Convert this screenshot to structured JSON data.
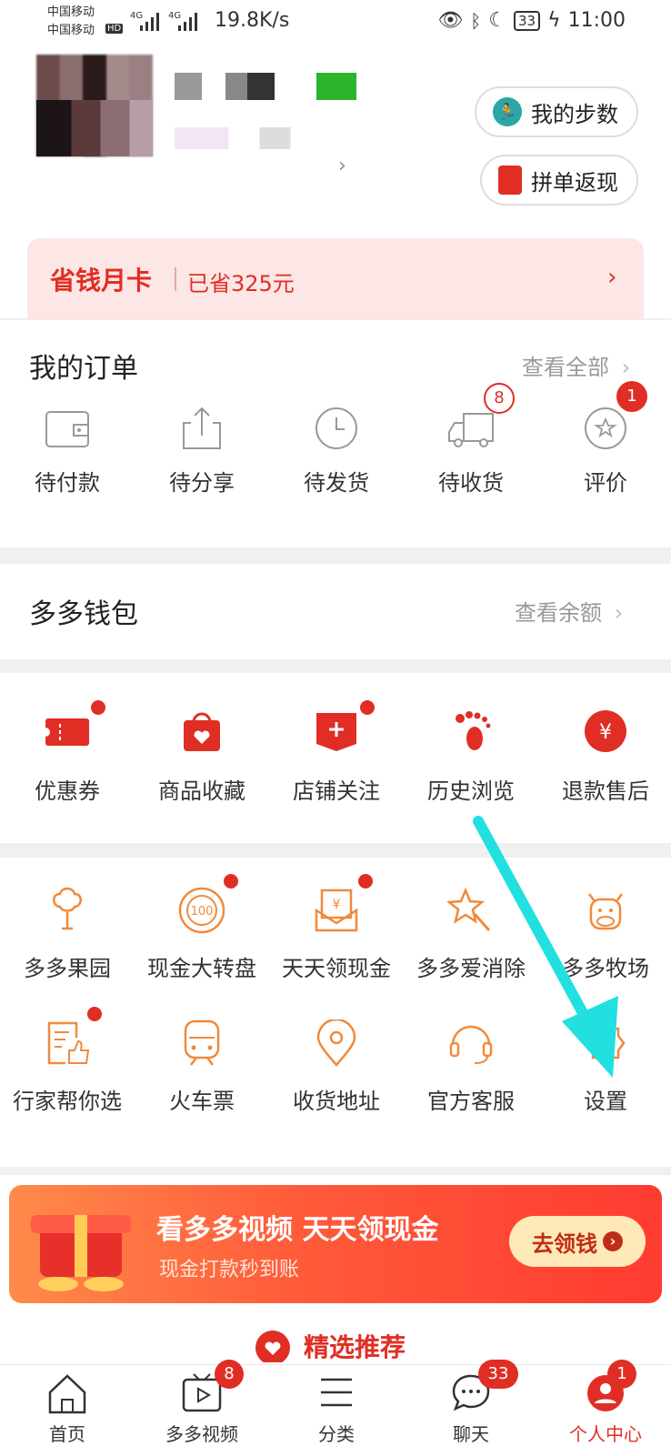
{
  "status_bar": {
    "carrier1": "中国移动",
    "carrier2": "中国移动",
    "hd": "HD",
    "net": "4G",
    "speed": "19.8K/s",
    "battery": "33",
    "time": "11:00"
  },
  "header": {
    "steps_label": "我的步数",
    "cashback_label": "拼单返现"
  },
  "monthly_card": {
    "title": "省钱月卡",
    "saved": "已省325元"
  },
  "orders": {
    "title": "我的订单",
    "view_all": "查看全部",
    "items": [
      {
        "label": "待付款",
        "icon": "wallet-icon"
      },
      {
        "label": "待分享",
        "icon": "share-icon"
      },
      {
        "label": "待发货",
        "icon": "clock-icon"
      },
      {
        "label": "待收货",
        "icon": "truck-icon",
        "badge": "8"
      },
      {
        "label": "评价",
        "icon": "star-review-icon",
        "badge": "1"
      }
    ]
  },
  "wallet": {
    "title": "多多钱包",
    "link": "查看余额"
  },
  "services1": [
    {
      "label": "优惠券",
      "icon": "coupon-icon"
    },
    {
      "label": "商品收藏",
      "icon": "favorite-bag-icon"
    },
    {
      "label": "店铺关注",
      "icon": "store-follow-icon"
    },
    {
      "label": "历史浏览",
      "icon": "footprint-icon"
    },
    {
      "label": "退款售后",
      "icon": "refund-icon"
    }
  ],
  "services2": [
    {
      "label": "多多果园",
      "icon": "tree-icon"
    },
    {
      "label": "现金大转盘",
      "icon": "wheel-icon"
    },
    {
      "label": "天天领现金",
      "icon": "cash-envelope-icon"
    },
    {
      "label": "多多爱消除",
      "icon": "star-wand-icon"
    },
    {
      "label": "多多牧场",
      "icon": "cow-icon"
    },
    {
      "label": "行家帮你选",
      "icon": "thumbs-up-doc-icon"
    },
    {
      "label": "火车票",
      "icon": "train-icon"
    },
    {
      "label": "收货地址",
      "icon": "location-icon"
    },
    {
      "label": "官方客服",
      "icon": "headset-icon"
    },
    {
      "label": "设置",
      "icon": "settings-gear-icon"
    }
  ],
  "banner": {
    "title": "看多多视频 天天领现金",
    "subtitle": "现金打款秒到账",
    "button": "去领钱"
  },
  "recommend": {
    "title": "精选推荐"
  },
  "bottom_nav": [
    {
      "label": "首页",
      "icon": "home-icon"
    },
    {
      "label": "多多视频",
      "icon": "video-icon",
      "badge": "8"
    },
    {
      "label": "分类",
      "icon": "category-icon"
    },
    {
      "label": "聊天",
      "icon": "chat-icon",
      "badge": "33"
    },
    {
      "label": "个人中心",
      "icon": "profile-icon",
      "badge": "1"
    }
  ],
  "colors": {
    "accent": "#e02e24",
    "service_orange": "#f08a3c",
    "annotation_arrow": "#22e0e0"
  }
}
